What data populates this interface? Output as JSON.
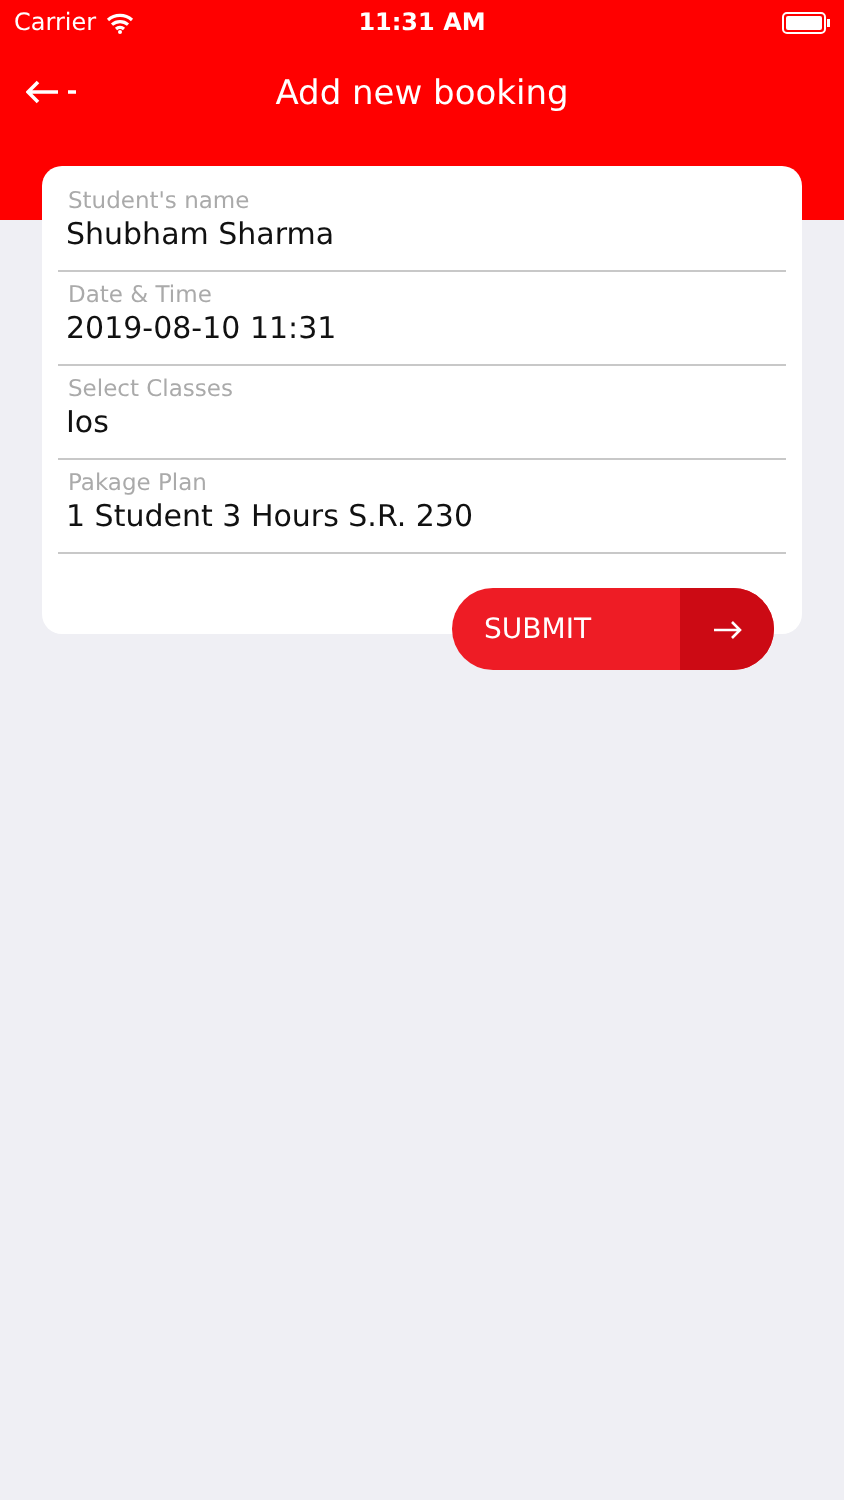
{
  "status_bar": {
    "carrier": "Carrier",
    "time": "11:31 AM"
  },
  "header": {
    "title": "Add new booking"
  },
  "form": {
    "fields": [
      {
        "label": "Student's name",
        "value": "Shubham Sharma"
      },
      {
        "label": "Date & Time",
        "value": "2019-08-10 11:31"
      },
      {
        "label": "Select Classes",
        "value": "Ios"
      },
      {
        "label": "Pakage Plan",
        "value": "1 Student 3 Hours S.R. 230"
      }
    ],
    "submit": "SUBMIT"
  }
}
